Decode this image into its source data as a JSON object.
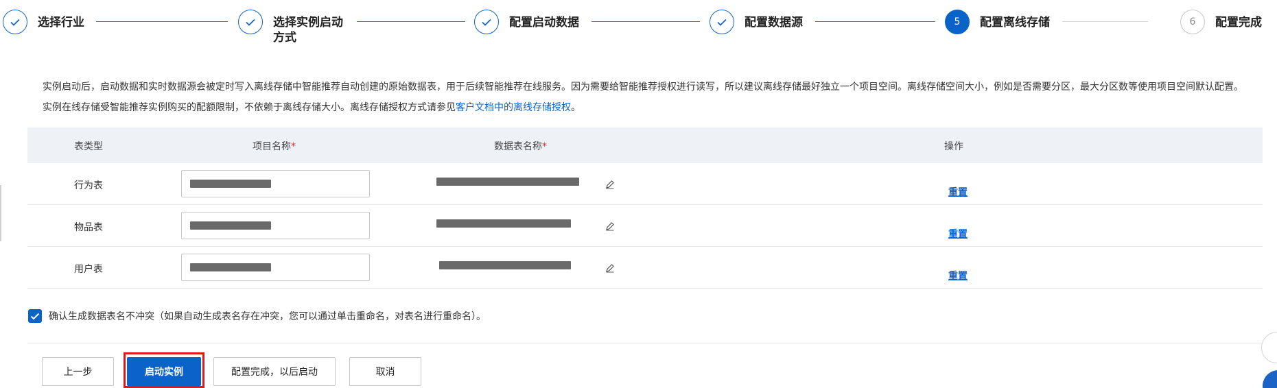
{
  "steps": [
    {
      "label": "选择行业",
      "state": "done"
    },
    {
      "label": "选择实例启动方式",
      "state": "done"
    },
    {
      "label": "配置启动数据",
      "state": "done"
    },
    {
      "label": "配置数据源",
      "state": "done"
    },
    {
      "label": "配置离线存储",
      "state": "active",
      "number": "5"
    },
    {
      "label": "配置完成",
      "state": "todo",
      "number": "6"
    }
  ],
  "description": {
    "text": "实例启动后，启动数据和实时数据源会被定时写入离线存储中智能推荐自动创建的原始数据表，用于后续智能推荐在线服务。因为需要给智能推荐授权进行读写，所以建议离线存储最好独立一个项目空间。离线存储空间大小，例如是否需要分区，最大分区数等使用项目空间默认配置。实例在线存储受智能推荐实例购买的配额限制，不依赖于离线存储大小。离线存储授权方式请参见",
    "link": "客户文档中的离线存储授权",
    "suffix": "。"
  },
  "table": {
    "headers": {
      "type": "表类型",
      "project": "项目名称",
      "table_name": "数据表名称",
      "action": "操作",
      "required_mark": "*"
    },
    "rows": [
      {
        "type": "行为表",
        "action": "重置"
      },
      {
        "type": "物品表",
        "action": "重置"
      },
      {
        "type": "用户表",
        "action": "重置"
      }
    ]
  },
  "confirm": {
    "checked": true,
    "label": "确认生成数据表名不冲突（如果自动生成表名存在冲突，您可以通过单击重命名，对表名进行重命名）。"
  },
  "buttons": {
    "prev": "上一步",
    "start": "启动实例",
    "config_later": "配置完成，以后启动",
    "cancel": "取消"
  },
  "colors": {
    "accent": "#0a63c9",
    "highlight": "#e0191d",
    "header_bg": "#eef2f7"
  },
  "icons": {
    "check": "check-icon",
    "edit": "edit-icon"
  }
}
